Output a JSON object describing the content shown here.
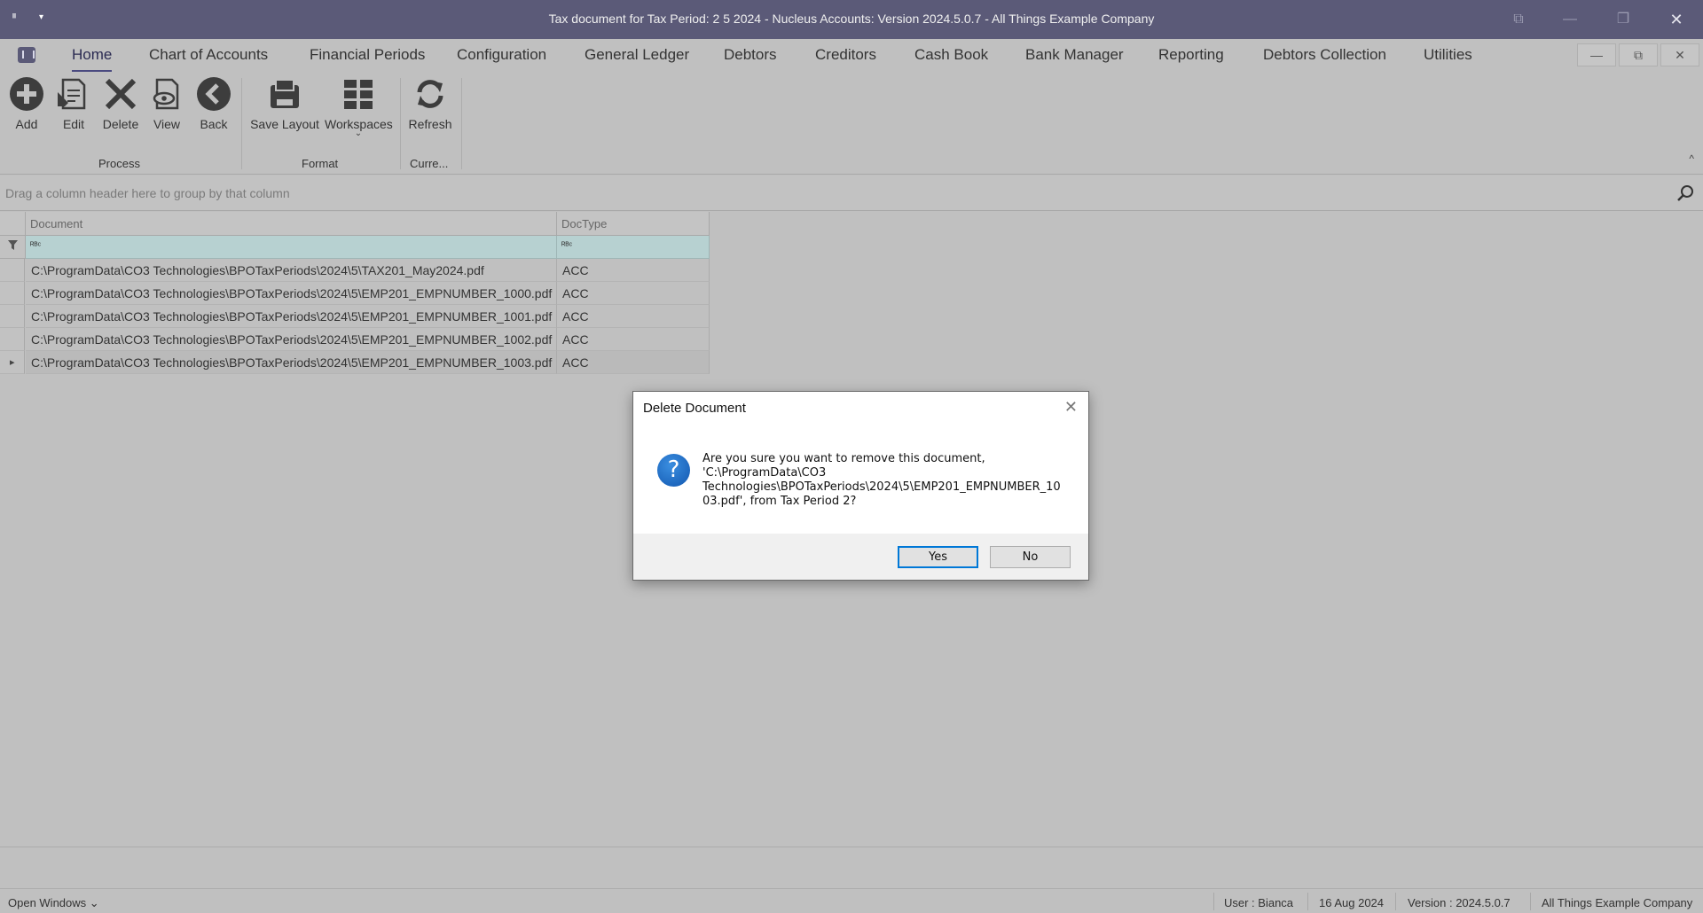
{
  "window": {
    "title": "Tax document for Tax Period: 2 5 2024 - Nucleus Accounts: Version 2024.5.0.7 - All Things Example Company",
    "app_icon_text": "ᴵᴵ",
    "qa_dropdown": "▾",
    "icon_buttons": {
      "a": "⧉",
      "minimize": "—",
      "restore": "❐",
      "close": "✕"
    }
  },
  "menu": {
    "items": [
      "Home",
      "Chart of Accounts",
      "Financial Periods",
      "Configuration",
      "General Ledger",
      "Debtors",
      "Creditors",
      "Cash Book",
      "Bank Manager",
      "Reporting",
      "Debtors Collection",
      "Utilities"
    ],
    "active": "Home",
    "mdi_buttons": {
      "minimize": "—",
      "restore": "⧉",
      "close": "✕"
    }
  },
  "ribbon": {
    "buttons": {
      "add": "Add",
      "edit": "Edit",
      "delete": "Delete",
      "view": "View",
      "back": "Back",
      "save_layout": "Save Layout",
      "workspaces": "Workspaces",
      "refresh": "Refresh"
    },
    "workspaces_arrow": "⌄",
    "groups": {
      "process": "Process",
      "format": "Format",
      "current": "Curre..."
    },
    "collapse_glyph": "^"
  },
  "group_panel": {
    "hint": "Drag a column header here to group by that column"
  },
  "grid": {
    "columns": [
      "Document",
      "DocType"
    ],
    "filter_glyph": "ᴿᴮᶜ",
    "rows": [
      {
        "document": "C:\\ProgramData\\CO3 Technologies\\BPOTaxPeriods\\2024\\5\\TAX201_May2024.pdf",
        "doctype": "ACC"
      },
      {
        "document": "C:\\ProgramData\\CO3 Technologies\\BPOTaxPeriods\\2024\\5\\EMP201_EMPNUMBER_1000.pdf",
        "doctype": "ACC"
      },
      {
        "document": "C:\\ProgramData\\CO3 Technologies\\BPOTaxPeriods\\2024\\5\\EMP201_EMPNUMBER_1001.pdf",
        "doctype": "ACC"
      },
      {
        "document": "C:\\ProgramData\\CO3 Technologies\\BPOTaxPeriods\\2024\\5\\EMP201_EMPNUMBER_1002.pdf",
        "doctype": "ACC"
      },
      {
        "document": "C:\\ProgramData\\CO3 Technologies\\BPOTaxPeriods\\2024\\5\\EMP201_EMPNUMBER_1003.pdf",
        "doctype": "ACC"
      }
    ],
    "focused_row": 4,
    "row_indicator": "▸"
  },
  "dialog": {
    "title": "Delete Document",
    "close_glyph": "✕",
    "icon_glyph": "?",
    "message_lines": [
      "Are you sure you want to remove this document,",
      "'C:\\ProgramData\\CO3",
      "Technologies\\BPOTaxPeriods\\2024\\5\\EMP201_EMPNUMBER_10",
      "03.pdf', from Tax Period 2?"
    ],
    "yes": "Yes",
    "no": "No"
  },
  "status": {
    "open_windows": "Open Windows ⌄",
    "user": "User : Bianca",
    "date": "16 Aug 2024",
    "version": "Version : 2024.5.0.7",
    "company": "All Things Example Company"
  }
}
